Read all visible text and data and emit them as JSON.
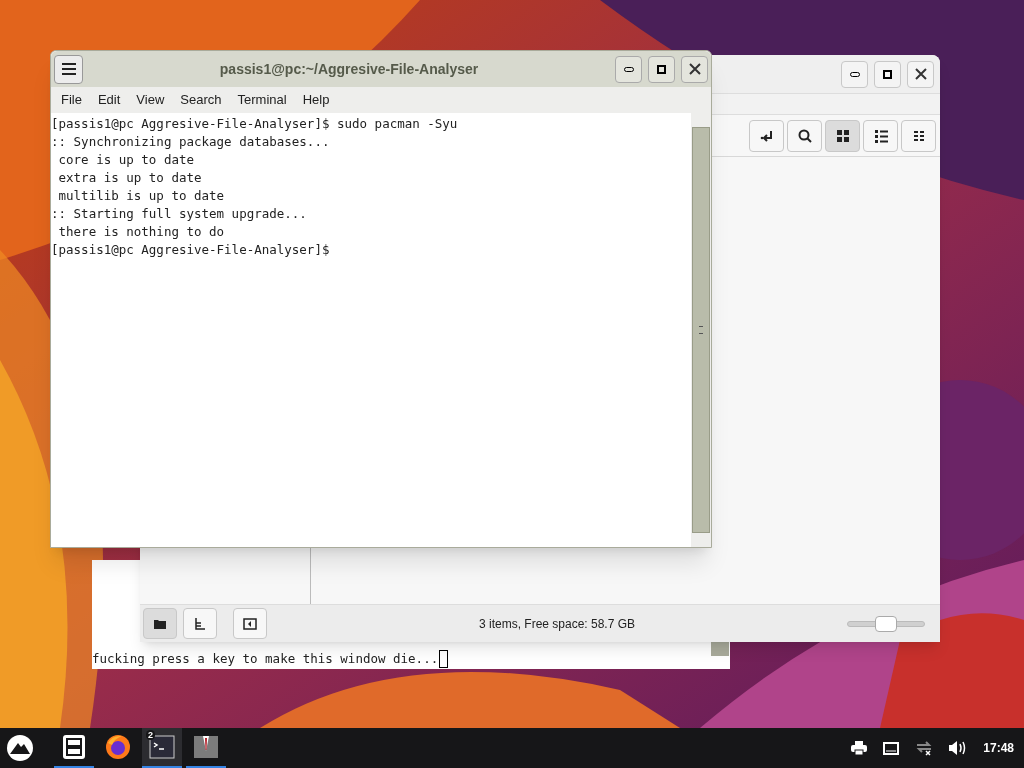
{
  "background_terminal": {
    "lines": [
      "fucking press a key to make this window die..."
    ]
  },
  "file_manager": {
    "toolbar": [
      {
        "kind": "return",
        "selected": false
      },
      {
        "kind": "search",
        "selected": false
      },
      {
        "kind": "icons",
        "selected": true
      },
      {
        "kind": "list",
        "selected": false
      },
      {
        "kind": "compact",
        "selected": false
      }
    ],
    "side_buttons": [
      {
        "kind": "places",
        "selected": true
      },
      {
        "kind": "tree",
        "selected": false
      },
      {
        "kind": "hide",
        "selected": false
      }
    ],
    "status": "3 items, Free space: 58.7 GB",
    "zoom": {
      "level": 0.5
    }
  },
  "terminal": {
    "title": "passis1@pc:~/Aggresive-File-Analyser",
    "menu": [
      "File",
      "Edit",
      "View",
      "Search",
      "Terminal",
      "Help"
    ],
    "lines": [
      "[passis1@pc Aggresive-File-Analyser]$ sudo pacman -Syu",
      ":: Synchronizing package databases...",
      " core is up to date",
      " extra is up to date",
      " multilib is up to date",
      ":: Starting full system upgrade...",
      " there is nothing to do",
      "[passis1@pc Aggresive-File-Analyser]$"
    ]
  },
  "taskbar": {
    "apps": [
      {
        "kind": "files",
        "active": true
      },
      {
        "kind": "browser",
        "active": false
      },
      {
        "kind": "terminal",
        "active": true,
        "badge": "2"
      },
      {
        "kind": "suit",
        "active": true
      }
    ],
    "clock": "17:48"
  }
}
